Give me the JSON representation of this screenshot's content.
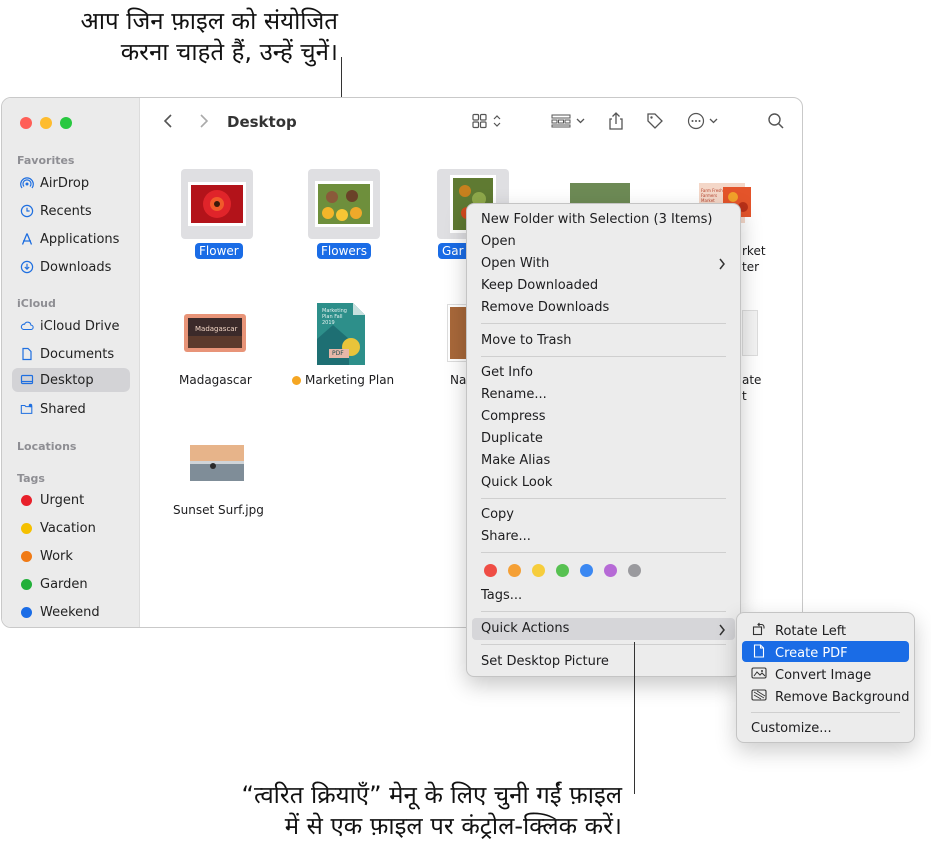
{
  "callouts": {
    "top_line1": "आप जिन फ़ाइल को संयोजित",
    "top_line2": "करना चाहते हैं, उन्हें चुनें।",
    "bottom_line1": "“त्वरित क्रियाएँ” मेनू के लिए चुनी गईं फ़ाइल",
    "bottom_line2": "में से एक फ़ाइल पर कंट्रोल-क्लिक करें।"
  },
  "window": {
    "title": "Desktop",
    "traffic_lights": [
      "#ff5f57",
      "#febc2e",
      "#28c840"
    ],
    "toolbar": {
      "back_icon": "chevron-left",
      "forward_icon": "chevron-right",
      "view_icon": "grid-view",
      "group_icon": "group-by",
      "share_icon": "share",
      "tag_icon": "tag",
      "more_icon": "ellipsis-circle",
      "search_icon": "magnifying-glass"
    }
  },
  "sidebar": {
    "favorites_heading": "Favorites",
    "favorites": [
      {
        "label": "AirDrop",
        "icon": "airdrop"
      },
      {
        "label": "Recents",
        "icon": "clock"
      },
      {
        "label": "Applications",
        "icon": "applications"
      },
      {
        "label": "Downloads",
        "icon": "download"
      }
    ],
    "icloud_heading": "iCloud",
    "icloud": [
      {
        "label": "iCloud Drive",
        "icon": "cloud"
      },
      {
        "label": "Documents",
        "icon": "document"
      },
      {
        "label": "Desktop",
        "icon": "desktop",
        "selected": true
      },
      {
        "label": "Shared",
        "icon": "shared-folder"
      }
    ],
    "locations_heading": "Locations",
    "tags_heading": "Tags",
    "tags": [
      {
        "label": "Urgent",
        "color": "#e8202a"
      },
      {
        "label": "Vacation",
        "color": "#f5c000"
      },
      {
        "label": "Work",
        "color": "#f07a15"
      },
      {
        "label": "Garden",
        "color": "#22b03a"
      },
      {
        "label": "Weekend",
        "color": "#1a6ce6"
      }
    ]
  },
  "files": {
    "flower": "Flower",
    "flowers": "Flowers",
    "garden_partial": "Gar",
    "market_partial_1": "rket",
    "market_partial_2": "ter",
    "madagascar": "Madagascar",
    "marketing_plan": "Marketing Plan",
    "marketing_plan_tag_color": "#f5a623",
    "marketing_cover_text": "Marketing Plan Fall 2019",
    "marketing_pdf_text": "PDF",
    "market_cover_text": "Farm Fresh Farmers Market",
    "madagascar_cover_text": "Madagascar",
    "na_partial": "Na",
    "ate_partial_1": "ate",
    "ate_partial_2": "t",
    "sunset": "Sunset Surf.jpg"
  },
  "context_menu": {
    "new_folder": "New Folder with Selection (3 Items)",
    "open": "Open",
    "open_with": "Open With",
    "keep_downloaded": "Keep Downloaded",
    "remove_downloads": "Remove Downloads",
    "move_to_trash": "Move to Trash",
    "get_info": "Get Info",
    "rename": "Rename...",
    "compress": "Compress",
    "duplicate": "Duplicate",
    "make_alias": "Make Alias",
    "quick_look": "Quick Look",
    "copy": "Copy",
    "share": "Share...",
    "tag_colors": [
      "#ef4d45",
      "#f5a035",
      "#f6cd3c",
      "#57c151",
      "#3b88f2",
      "#b66ad6",
      "#9a9a9e"
    ],
    "tags": "Tags...",
    "quick_actions": "Quick Actions",
    "set_desktop_picture": "Set Desktop Picture"
  },
  "submenu": {
    "rotate_left": "Rotate Left",
    "create_pdf": "Create PDF",
    "convert_image": "Convert Image",
    "remove_background": "Remove Background",
    "customize": "Customize..."
  }
}
